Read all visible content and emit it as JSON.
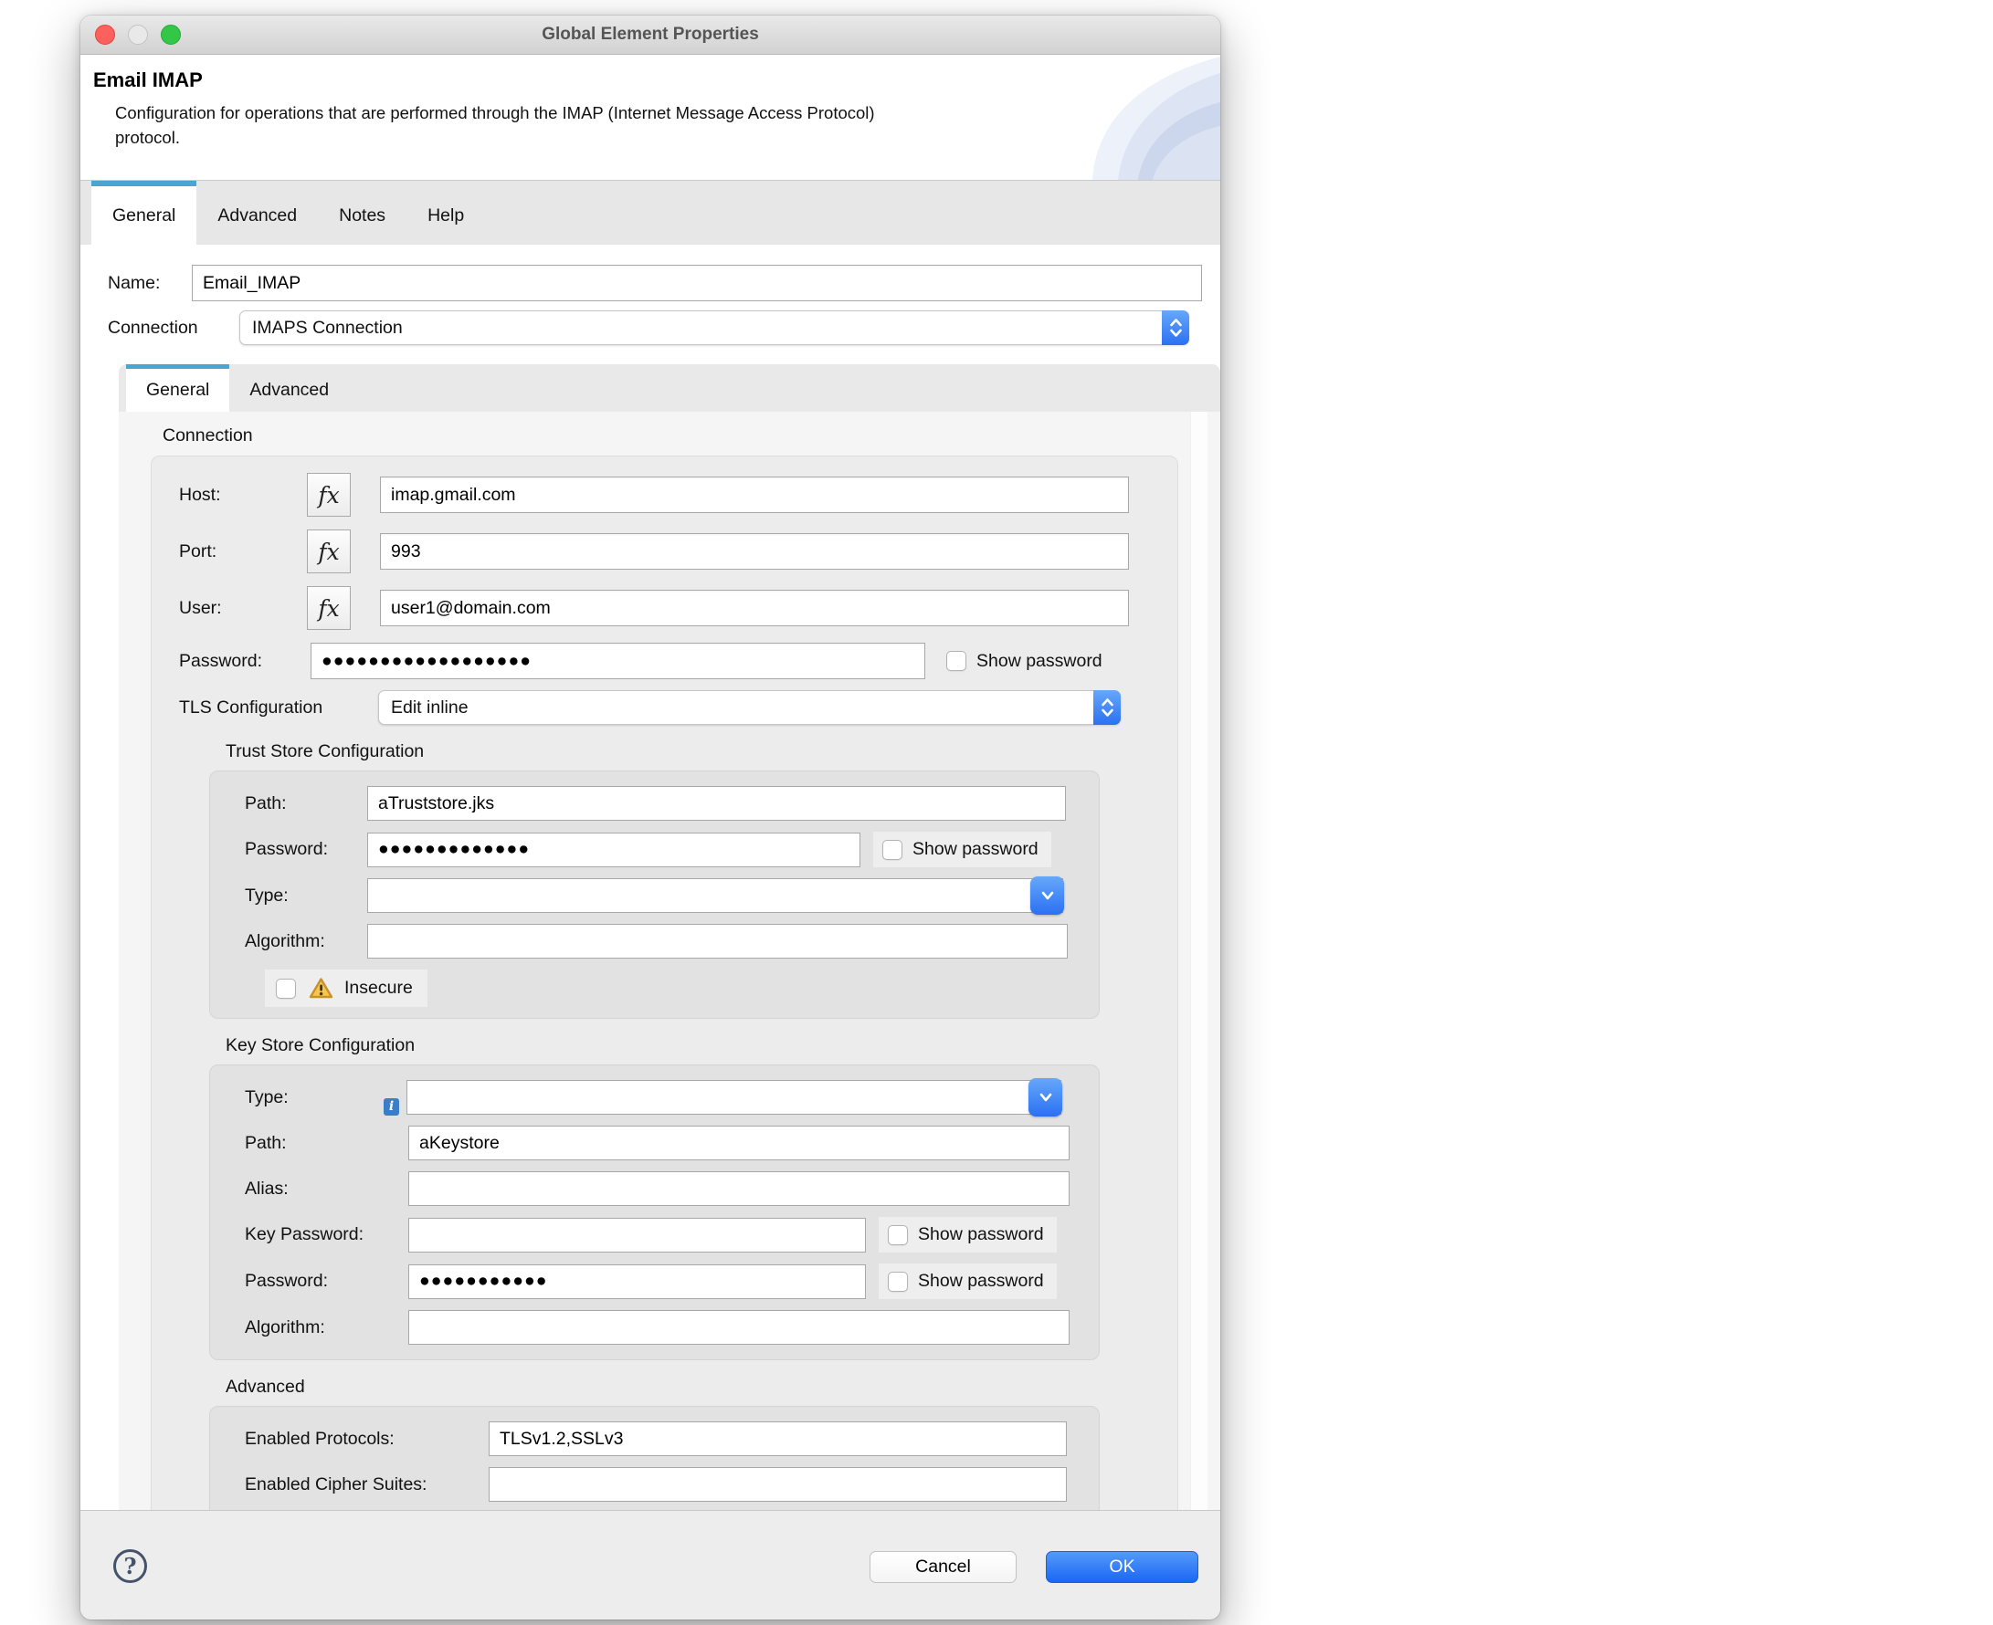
{
  "titlebar": {
    "title": "Global Element Properties"
  },
  "header": {
    "title": "Email IMAP",
    "description": "Configuration for operations that are performed through the IMAP (Internet Message Access Protocol) protocol."
  },
  "outer_tabs": {
    "items": [
      {
        "label": "General"
      },
      {
        "label": "Advanced"
      },
      {
        "label": "Notes"
      },
      {
        "label": "Help"
      }
    ]
  },
  "name_field": {
    "label": "Name:",
    "value": "Email_IMAP"
  },
  "connection_select": {
    "label": "Connection",
    "value": "IMAPS Connection"
  },
  "inner_tabs": {
    "items": [
      {
        "label": "General"
      },
      {
        "label": "Advanced"
      }
    ]
  },
  "connection_group": {
    "title": "Connection",
    "host": {
      "label": "Host:",
      "value": "imap.gmail.com"
    },
    "port": {
      "label": "Port:",
      "value": "993"
    },
    "user": {
      "label": "User:",
      "value": "user1@domain.com"
    },
    "password": {
      "label": "Password:",
      "value": "●●●●●●●●●●●●●●●●●●",
      "show_password_label": "Show password"
    },
    "tls": {
      "label": "TLS Configuration",
      "value": "Edit inline"
    }
  },
  "trust_store": {
    "title": "Trust Store Configuration",
    "path": {
      "label": "Path:",
      "value": "aTruststore.jks"
    },
    "password": {
      "label": "Password:",
      "value": "●●●●●●●●●●●●●",
      "show_password_label": "Show password"
    },
    "type": {
      "label": "Type:",
      "value": ""
    },
    "algorithm": {
      "label": "Algorithm:",
      "value": ""
    },
    "insecure": {
      "label": "Insecure"
    }
  },
  "key_store": {
    "title": "Key Store Configuration",
    "type": {
      "label": "Type:",
      "value": ""
    },
    "path": {
      "label": "Path:",
      "value": "aKeystore"
    },
    "alias": {
      "label": "Alias:",
      "value": ""
    },
    "key_password": {
      "label": "Key Password:",
      "value": "",
      "show_password_label": "Show password"
    },
    "password": {
      "label": "Password:",
      "value": "●●●●●●●●●●●",
      "show_password_label": "Show password"
    },
    "algorithm": {
      "label": "Algorithm:",
      "value": ""
    }
  },
  "advanced_group": {
    "title": "Advanced",
    "enabled_protocols": {
      "label": "Enabled Protocols:",
      "value": "TLSv1.2,SSLv3"
    },
    "enabled_cipher_suites": {
      "label": "Enabled Cipher Suites:",
      "value": ""
    }
  },
  "footer": {
    "cancel_label": "Cancel",
    "ok_label": "OK"
  },
  "icons": {
    "fx_glyph": "fx",
    "help_glyph": "?",
    "info_glyph": "i"
  },
  "colors": {
    "accent_blue": "#2b70f2",
    "tab_accent": "#4ba5d2",
    "warning": "#f6c64f",
    "traffic_red": "#fc615d",
    "traffic_green": "#33c748",
    "ok_button": "#1a67f3"
  }
}
